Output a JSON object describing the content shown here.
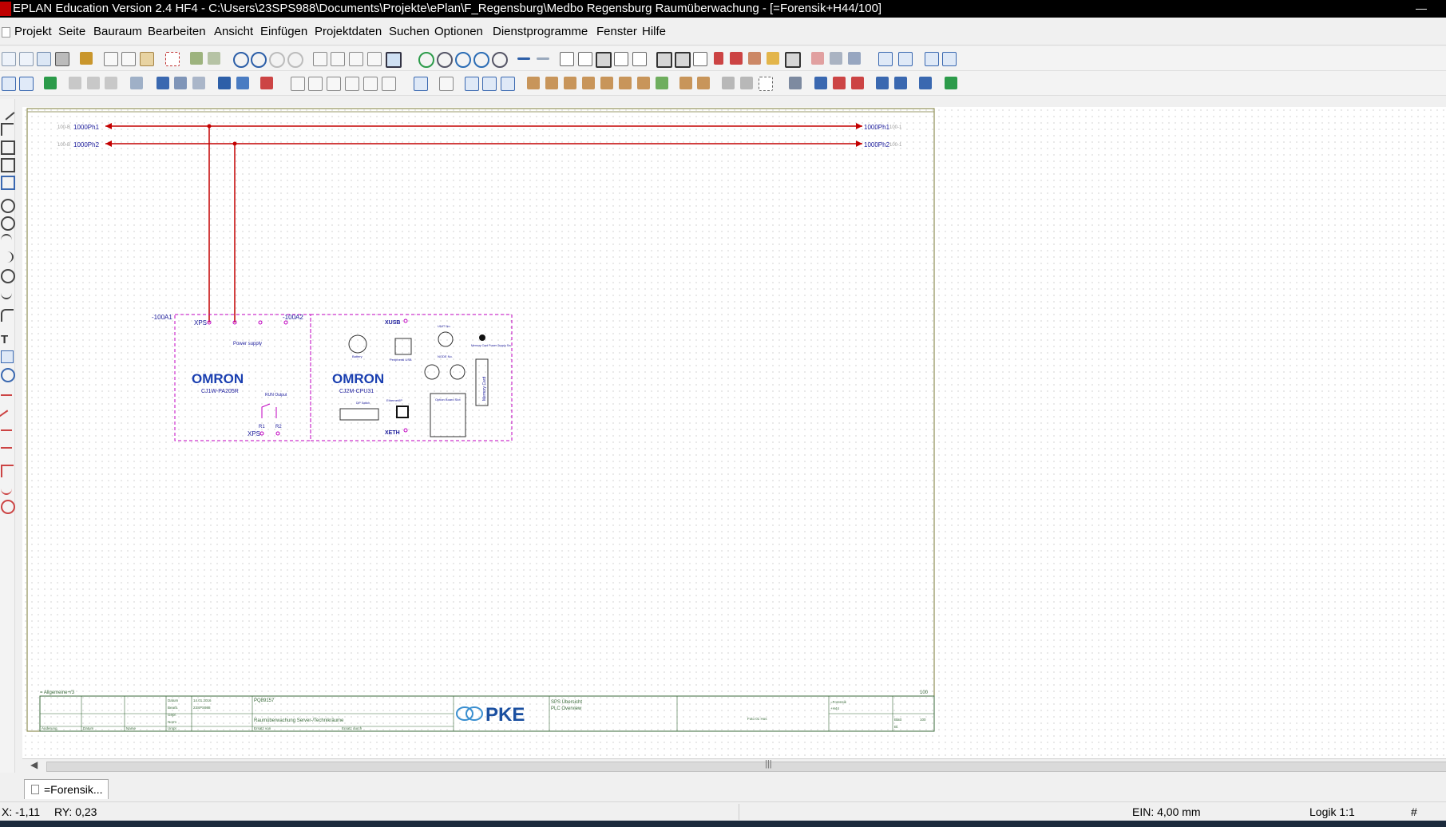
{
  "window": {
    "title": "EPLAN Education Version 2.4 HF4 - C:\\Users\\23SPS988\\Documents\\Projekte\\ePlan\\F_Regensburg\\Medbo Regensburg Raumüberwachung - [=Forensik+H44/100]",
    "minimize_glyph": "—"
  },
  "menu": [
    "Projekt",
    "Seite",
    "Bauraum",
    "Bearbeiten",
    "Ansicht",
    "Einfügen",
    "Projektdaten",
    "Suchen",
    "Optionen",
    "Dienstprogramme",
    "Fenster",
    "Hilfe"
  ],
  "schematic": {
    "bus_labels": {
      "ph1_left": "1000Ph1",
      "ph2_left": "1000Ph2",
      "ph1_right": "1000Ph1",
      "ph2_right": "1000Ph2",
      "ph1_left_small": "100-B",
      "ph2_left_small": "100-B",
      "ph1_right_small": "100-1",
      "ph2_right_small": "100-1"
    },
    "psu": {
      "tag": "-100A1",
      "brand": "OMRON",
      "model": "CJ1W-PA205R",
      "power_supply_label": "Power supply",
      "xps_top": "XPS",
      "xps_bottom": "XPS",
      "relay_label": "RUN Output",
      "term_r1": "R1",
      "term_r2": "R2"
    },
    "cpu": {
      "tag": "-100A2",
      "brand": "OMRON",
      "model": "CJ2M-CPU31",
      "xusb": "XUSB",
      "xeth": "XETH",
      "battery": "Battery",
      "usb_port": "Peripheral USB",
      "unit_no": "UNIT No.",
      "node_no": "NODE No.",
      "memory_card": "Memory Card",
      "memory_card_power": "Memory Card Power Supply Sw",
      "ethernet": "Ethernet/IP",
      "option_board": "Option Board Slot",
      "dip_switch": "DIP Switch"
    },
    "title_block": {
      "company": "PKE",
      "project_no": "PQ89157",
      "description": "Raumüberwachung Server-/Technikräume",
      "page_title_1": "SPS Übersicht",
      "page_title_2": "PLC Overview",
      "date": "14.01.2016",
      "editor": "23SPS988",
      "location_1": "=Forensik",
      "location_2": "+H44",
      "page": "100",
      "sheet_count": "100",
      "page_label_left": "= Allgemeine+/3",
      "revision_no": "Foto 01 Hos",
      "lbl_datum": "Datum",
      "lbl_bearb": "Bearb.",
      "lbl_gepr": "Gepr.",
      "lbl_norm": "Norm",
      "lbl_urspr": "Urspr.",
      "lbl_aenderung": "Änderung",
      "lbl_name": "Name",
      "lbl_ersetzt_von": "Ersatz von",
      "lbl_ersetzt_durch": "Ersatz durch",
      "lbl_blatt": "Blatt",
      "lbl_bl": "Bl."
    }
  },
  "tab": {
    "label": "=Forensik..."
  },
  "status": {
    "x": "X: -1,11",
    "y": "RY: 0,23",
    "increment": "EIN: 4,00 mm",
    "logic": "Logik 1:1",
    "hash": "#"
  }
}
